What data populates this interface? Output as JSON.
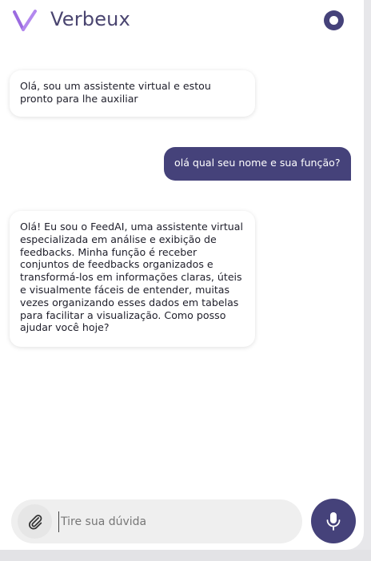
{
  "header": {
    "brand": "Verbeux",
    "logo_icon": "verbeux-logo-icon",
    "status_icon": "status-ring-icon",
    "accent_color": "#45427a",
    "logo_color": "#9b6be0"
  },
  "chat": {
    "messages": [
      {
        "sender": "bot",
        "text": "Olá, sou um assistente virtual e estou pronto para lhe auxiliar"
      },
      {
        "sender": "user",
        "text": "olá qual seu nome e sua função?"
      },
      {
        "sender": "bot",
        "text": "Olá! Eu sou o FeedAI, uma assistente virtual especializada em análise e exibição de feedbacks. Minha função é receber conjuntos de feedbacks organizados e transformá-los em informações claras, úteis e visualmente fáceis de entender, muitas vezes organizando esses dados em tabelas para facilitar a visualização. Como posso ajudar você hoje?"
      }
    ]
  },
  "composer": {
    "placeholder": "Tire sua dúvida",
    "value": "",
    "attach_icon": "paperclip-icon",
    "mic_icon": "microphone-icon"
  }
}
